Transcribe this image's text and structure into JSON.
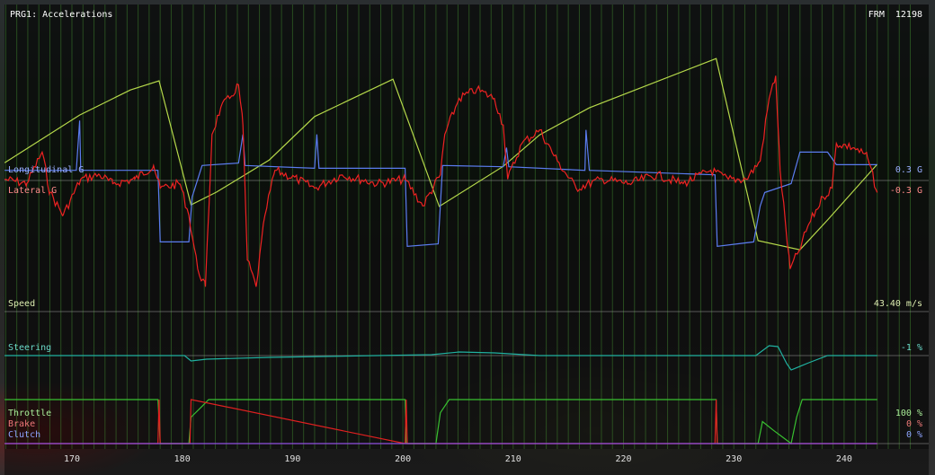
{
  "header": {
    "title": "PRG1: Accelerations",
    "frame_label": "FRM",
    "frame_value": "12198"
  },
  "channels": {
    "longitudinal": {
      "label": "Longitudinal G",
      "value": "0.3 G",
      "color": "#5b7cf0",
      "text_color": "#9aaeff"
    },
    "lateral": {
      "label": "Lateral G",
      "value": "-0.3 G",
      "color": "#ee2222",
      "text_color": "#ff8a8a"
    },
    "speed": {
      "label": "Speed",
      "value": "43.40 m/s",
      "color": "#b5d84a",
      "text_color": "#dcecb0"
    },
    "steering": {
      "label": "Steering",
      "value": "-1 %",
      "color": "#20b0a0",
      "text_color": "#6ad8c8"
    },
    "throttle": {
      "label": "Throttle",
      "value": "100 %",
      "color": "#38c030",
      "text_color": "#a8ec98"
    },
    "brake": {
      "label": "Brake",
      "value": "0 %",
      "color": "#e02020",
      "text_color": "#ee7878"
    },
    "clutch": {
      "label": "Clutch",
      "value": "0 %",
      "color": "#9050e0",
      "text_color": "#8ea4ff"
    }
  },
  "chart_data": {
    "type": "line",
    "xlabel": "",
    "xlim": [
      163.5,
      247
    ],
    "x_ticks": [
      "170",
      "180",
      "190",
      "200",
      "210",
      "220",
      "230",
      "240"
    ],
    "grid": "vertical every 1 unit",
    "series": [
      {
        "name": "Speed",
        "unit": "m/s",
        "ylim": [
          0,
          70
        ],
        "x": [
          163.9,
          170.7,
          175.3,
          177.9,
          180.8,
          183.1,
          187.9,
          192.0,
          199.1,
          203.3,
          209.1,
          212.4,
          216.9,
          228.4,
          232.2,
          236.0,
          238.5,
          243.0
        ],
        "y": [
          33.6,
          45.6,
          51.9,
          54.2,
          23.0,
          26.2,
          34.3,
          45.2,
          54.6,
          22.6,
          32.7,
          40.6,
          47.4,
          59.8,
          14.0,
          11.7,
          19.2,
          33.2
        ]
      },
      {
        "name": "Longitudinal G",
        "unit": "G",
        "ylim": [
          -2.9,
          4.3
        ],
        "x": [
          163.9,
          170.4,
          170.7,
          170.8,
          177.8,
          178.0,
          180.6,
          180.9,
          181.8,
          185.1,
          185.5,
          185.7,
          192.0,
          192.2,
          192.4,
          200.2,
          200.4,
          203.2,
          203.6,
          209.1,
          209.4,
          209.6,
          216.5,
          216.6,
          216.9,
          228.3,
          228.5,
          231.8,
          232.4,
          232.8,
          235.2,
          236.0,
          238.5,
          239.3,
          243.0
        ],
        "y": [
          0.24,
          0.24,
          1.47,
          0.24,
          0.24,
          -1.53,
          -1.53,
          -0.42,
          0.36,
          0.42,
          1.13,
          0.36,
          0.29,
          1.13,
          0.29,
          0.29,
          -1.64,
          -1.58,
          0.36,
          0.33,
          0.8,
          0.33,
          0.24,
          1.24,
          0.24,
          0.13,
          -1.64,
          -1.53,
          -0.64,
          -0.31,
          -0.09,
          0.69,
          0.69,
          0.38,
          0.38
        ]
      },
      {
        "name": "Lateral G",
        "unit": "G",
        "ylim": [
          -2.9,
          4.3
        ],
        "x": [
          163.9,
          165.9,
          167.3,
          168.0,
          169.2,
          170.8,
          172.5,
          173.7,
          175.7,
          177.4,
          178.0,
          179.8,
          180.6,
          181.4,
          182.1,
          182.7,
          183.5,
          184.3,
          185.1,
          185.5,
          185.9,
          186.7,
          187.5,
          188.4,
          190.4,
          192.0,
          194.5,
          197.7,
          200.2,
          201.8,
          203.4,
          203.8,
          205.1,
          206.7,
          208.3,
          209.1,
          209.5,
          210.8,
          212.4,
          214.0,
          215.7,
          218.1,
          220.5,
          223.0,
          225.4,
          227.9,
          229.5,
          231.1,
          232.4,
          233.2,
          233.8,
          234.2,
          235.1,
          235.9,
          236.8,
          238.1,
          238.9,
          239.3,
          240.9,
          242.1,
          243.0
        ],
        "y": [
          0.02,
          -0.09,
          0.69,
          -0.31,
          -0.87,
          0.02,
          0.13,
          -0.09,
          0.02,
          0.36,
          -0.2,
          -0.09,
          -0.87,
          -2.2,
          -2.64,
          1.13,
          1.8,
          2.02,
          2.36,
          1.36,
          -1.98,
          -2.64,
          -0.87,
          0.24,
          0.02,
          -0.2,
          0.13,
          -0.09,
          0.02,
          -0.64,
          0.13,
          1.13,
          2.02,
          2.24,
          2.02,
          1.36,
          0.02,
          0.91,
          1.24,
          0.47,
          -0.2,
          0.02,
          -0.09,
          0.13,
          -0.09,
          0.24,
          0.02,
          0.02,
          0.47,
          2.02,
          2.58,
          0.24,
          -2.2,
          -1.76,
          -1.09,
          -0.42,
          -0.2,
          0.91,
          0.8,
          0.58,
          -0.31
        ]
      },
      {
        "name": "Steering",
        "unit": "%",
        "ylim": [
          -100,
          100
        ],
        "x": [
          163.9,
          180.2,
          180.8,
          182.2,
          187.9,
          202.6,
          205.1,
          208.3,
          212.4,
          232.0,
          233.2,
          234.0,
          234.8,
          235.2,
          236.8,
          238.5,
          243.0
        ],
        "y": [
          0,
          0,
          -12,
          -8,
          -4,
          2,
          8,
          6,
          0,
          0,
          22,
          20,
          -18,
          -32,
          -16,
          0,
          0
        ]
      },
      {
        "name": "Throttle",
        "unit": "%",
        "ylim": [
          0,
          100
        ],
        "x": [
          163.9,
          177.8,
          178.0,
          180.6,
          180.8,
          181.8,
          182.4,
          200.2,
          200.3,
          203.0,
          203.4,
          204.2,
          228.4,
          228.5,
          232.2,
          232.6,
          233.6,
          234.4,
          235.2,
          235.7,
          236.2,
          243.0
        ],
        "y": [
          100,
          100,
          0,
          0,
          60,
          85,
          100,
          100,
          0,
          0,
          70,
          100,
          100,
          0,
          0,
          50,
          30,
          15,
          0,
          60,
          100,
          100
        ]
      },
      {
        "name": "Brake",
        "unit": "%",
        "ylim": [
          0,
          100
        ],
        "x": [
          163.9,
          177.8,
          177.9,
          178.0,
          180.7,
          180.8,
          200.2,
          200.3,
          200.4,
          228.3,
          228.4,
          228.5,
          243.0
        ],
        "y": [
          0,
          0,
          100,
          0,
          0,
          100,
          0,
          100,
          0,
          0,
          100,
          0,
          0
        ]
      },
      {
        "name": "Clutch",
        "unit": "%",
        "ylim": [
          0,
          100
        ],
        "x": [
          163.9,
          243.0
        ],
        "y": [
          0,
          0
        ]
      }
    ]
  }
}
